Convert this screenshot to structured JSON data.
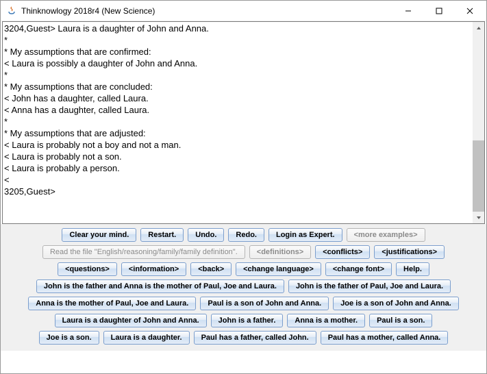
{
  "window": {
    "title": "Thinknowlogy 2018r4 (New Science)"
  },
  "console": {
    "text": "3204,Guest> Laura is a daughter of John and Anna.\n*\n* My assumptions that are confirmed:\n< Laura is possibly a daughter of John and Anna.\n*\n* My assumptions that are concluded:\n< John has a daughter, called Laura.\n< Anna has a daughter, called Laura.\n*\n* My assumptions that are adjusted:\n< Laura is probably not a boy and not a man.\n< Laura is probably not a son.\n< Laura is probably a person.\n<\n3205,Guest>"
  },
  "rows": {
    "r1": {
      "clear": "Clear your mind.",
      "restart": "Restart.",
      "undo": "Undo.",
      "redo": "Redo.",
      "login": "Login as Expert.",
      "more": "<more examples>"
    },
    "r2": {
      "readfile": "Read the file \"English/reasoning/family/family definition\".",
      "definitions": "<definitions>",
      "conflicts": "<conflicts>",
      "justifications": "<justifications>"
    },
    "r3": {
      "questions": "<questions>",
      "information": "<information>",
      "back": "<back>",
      "changelang": "<change language>",
      "changefont": "<change font>",
      "help": "Help."
    },
    "r4": {
      "a": "John is the father and Anna is the mother of Paul, Joe and Laura.",
      "b": "John is the father of Paul, Joe and Laura."
    },
    "r5": {
      "a": "Anna is the mother of Paul, Joe and Laura.",
      "b": "Paul is a son of John and Anna.",
      "c": "Joe is a son of John and Anna."
    },
    "r6": {
      "a": "Laura is a daughter of John and Anna.",
      "b": "John is a father.",
      "c": "Anna is a mother.",
      "d": "Paul is a son."
    },
    "r7": {
      "a": "Joe is a son.",
      "b": "Laura is a daughter.",
      "c": "Paul has a father, called John.",
      "d": "Paul has a mother, called Anna."
    }
  }
}
